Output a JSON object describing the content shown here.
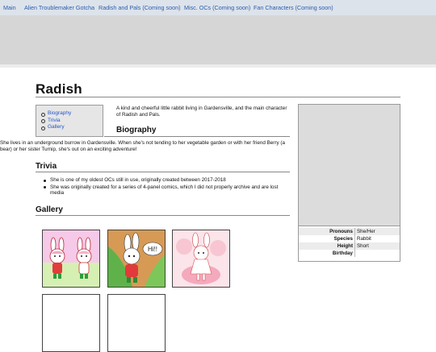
{
  "nav": {
    "items": [
      {
        "label": "Main"
      },
      {
        "label": "Alien Troublemaker Gotcha"
      },
      {
        "label": "Radish and Pals (Coming soon)"
      },
      {
        "label": "Misc. OCs (Coming soon)"
      },
      {
        "label": "Fan Characters (Coming soon)"
      }
    ]
  },
  "page": {
    "title": "Radish",
    "toc": [
      "Biography",
      "Trivia",
      "Gallery"
    ],
    "intro": "A kind and cheerful little rabbit living in Gardensville, and the main character of Radish and Pals.",
    "biography_heading": "Biography",
    "biography_text": "She lives in an underground burrow in Gardensville. When she's not tending to her vegetable garden or with her friend Berry (a bear) or her sister Turnip, she's out on an exciting adventure!",
    "trivia_heading": "Trivia",
    "trivia": [
      "She is one of my oldest OCs still in use, originally created between 2017-2018",
      "She was originally created for a series of 4-panel comics, which I did not properly archive and are lost media"
    ],
    "gallery_heading": "Gallery",
    "gallery_speech": "Hi!!"
  },
  "infobox": {
    "rows": [
      {
        "key": "Pronouns",
        "value": "She/Her"
      },
      {
        "key": "Species",
        "value": "Rabbit"
      },
      {
        "key": "Height",
        "value": "Short"
      },
      {
        "key": "Birthday",
        "value": ""
      }
    ]
  }
}
